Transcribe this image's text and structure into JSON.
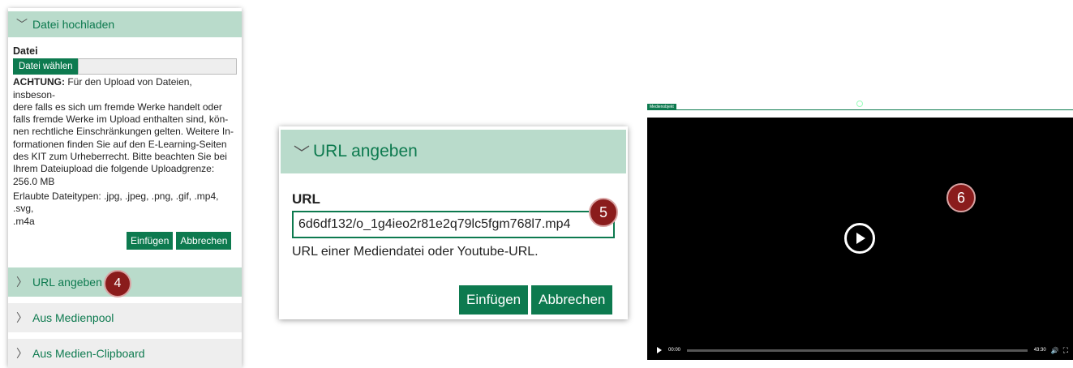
{
  "panel1": {
    "section_upload": "Datei hochladen",
    "field_label": "Datei",
    "choose_button": "Datei wählen",
    "notice_bold": "ACHTUNG:",
    "notice_lines": [
      " Für den Upload von Dateien, insbeson-",
      "dere falls es sich um fremde Werke handelt oder",
      "falls fremde Werke im Upload enthalten sind, kön-",
      "nen rechtliche Einschränkungen gelten. Weitere In-",
      "formationen finden Sie auf den E-Learning-Seiten",
      "des KIT zum Urheberrecht. Bitte beachten Sie bei",
      "Ihrem Dateiupload die folgende Uploadgrenze:",
      "256.0 MB"
    ],
    "allowed_types_lines": [
      "Erlaubte Dateitypen: .jpg, .jpeg, .png, .gif, .mp4, .svg,",
      ".m4a"
    ],
    "insert_button": "Einfügen",
    "cancel_button": "Abbrechen",
    "section_url": "URL angeben",
    "section_pool": "Aus Medienpool",
    "section_clipboard": "Aus Medien-Clipboard",
    "badge": "4"
  },
  "panel2": {
    "section_url": "URL angeben",
    "field_label": "URL",
    "url_value": "6d6df132/o_1g4ieo2r81e2q79lc5fgm768l7.mp4",
    "help_text": "URL einer Mediendatei oder Youtube-URL.",
    "insert_button": "Einfügen",
    "cancel_button": "Abbrechen",
    "badge": "5"
  },
  "panel3": {
    "label": "Medienobjekt",
    "time_current": "00:00",
    "time_total": "43:30",
    "badge": "6"
  },
  "icons": {
    "chevron_down": "chevron-down-icon",
    "chevron_right": "chevron-right-icon",
    "play": "play-icon",
    "volume": "volume-icon",
    "fullscreen": "fullscreen-icon"
  },
  "colors": {
    "accent": "#0d7a4f",
    "accent_light": "#b9dbcb",
    "badge": "#8a1c1c",
    "video_bg": "#000000"
  }
}
